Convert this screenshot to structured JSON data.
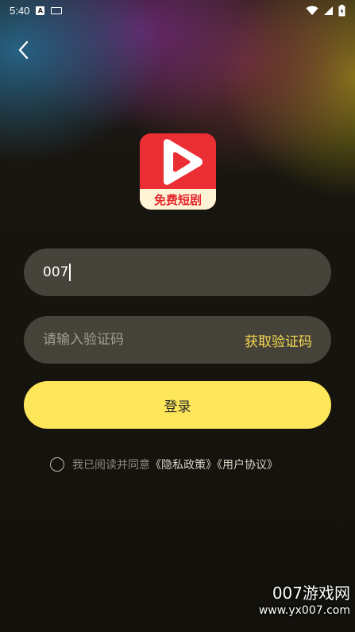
{
  "statusbar": {
    "time": "5:40",
    "a_icon_label": "A"
  },
  "logo": {
    "text": "免费短剧",
    "brand_color": "#ea2e34"
  },
  "phone": {
    "value": "007"
  },
  "code": {
    "placeholder": "请输入验证码",
    "get_code_label": "获取验证码"
  },
  "login": {
    "label": "登录",
    "color": "#fde65a"
  },
  "agreement": {
    "prefix": "我已阅读并同意",
    "privacy": "《隐私政策》",
    "terms": "《用户协议》"
  },
  "watermark": {
    "title": "007游戏网",
    "url": "www.yx007.com"
  }
}
